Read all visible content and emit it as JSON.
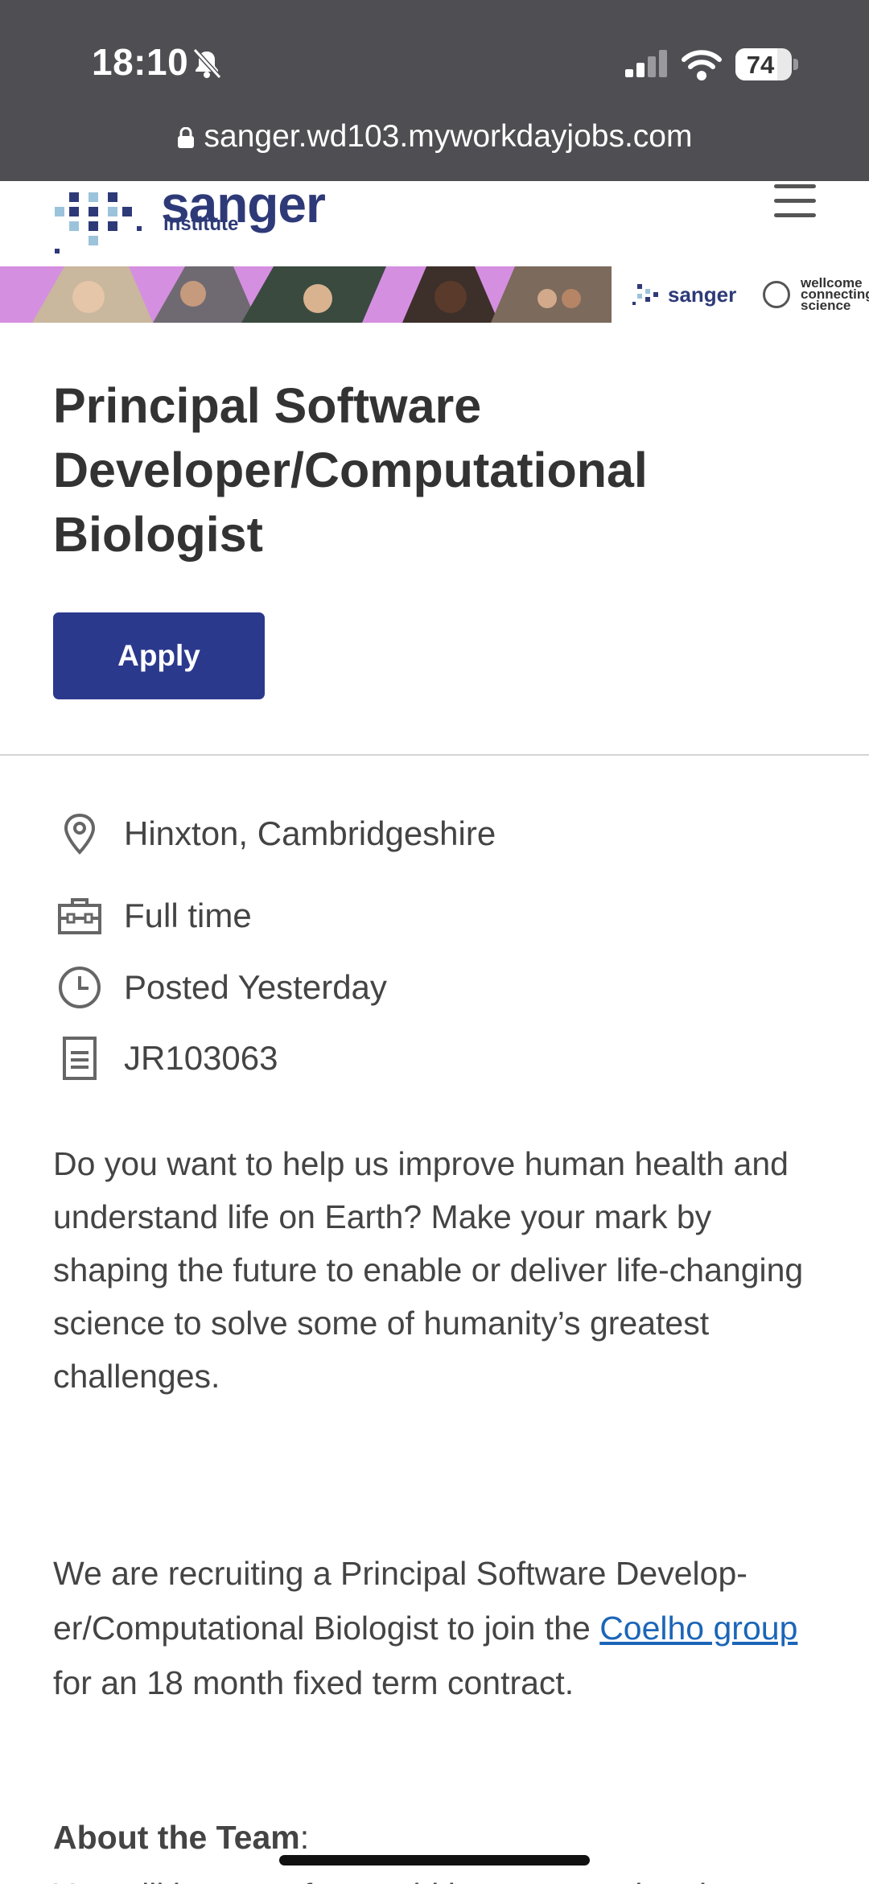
{
  "status_bar": {
    "time": "18:10",
    "battery": "74",
    "battery_fraction": 0.74
  },
  "browser": {
    "url": "sanger.wd103.myworkdayjobs.com"
  },
  "header": {
    "logo_name": "sanger",
    "logo_sub": "institute"
  },
  "banner": {
    "sanger": "sanger",
    "wellcome_lines": [
      "wellcome",
      "connecting",
      "science"
    ]
  },
  "job": {
    "title": "Principal Software Developer/Computational Biologist",
    "apply_label": "Apply",
    "location": "Hinxton, Cambridgeshire",
    "type": "Full time",
    "posted": "Posted Yesterday",
    "id": "JR103063"
  },
  "description": {
    "intro": "Do you want to help us improve human health and understand life on Earth? Make your mark by shaping the future to enable or deliver life-changing science to solve some of humanity’s greatest challenges.",
    "recruit_before": "We are recruiting a Principal Software Develop-er/Computational Biologist to join the",
    "recruit_link": "Coelho group",
    "recruit_after": "for an 18 month fixed term contract.",
    "about_heading": "About the Team",
    "about_colon": ":",
    "next_line": "You will be part of an ambitious new and project"
  },
  "icons": {
    "bell": "bell-slash-icon",
    "signal": "signal-icon",
    "wifi": "wifi-icon",
    "lock": "lock-icon",
    "menu": "hamburger-menu-icon",
    "location": "map-pin-icon",
    "type": "briefcase-icon",
    "posted": "clock-icon",
    "id": "document-icon"
  },
  "colors": {
    "brand": "#2e3a78",
    "apply": "#2b398d",
    "link": "#1b66b8",
    "banner": "#d58fe0"
  }
}
